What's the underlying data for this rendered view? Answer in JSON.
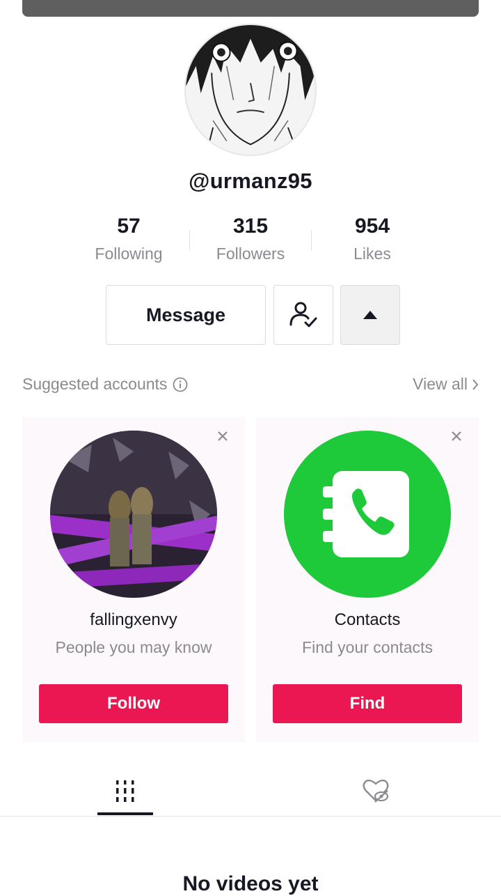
{
  "profile": {
    "username": "@urmanz95",
    "avatar_icon": "manga-portrait-avatar"
  },
  "stats": [
    {
      "value": "57",
      "label": "Following"
    },
    {
      "value": "315",
      "label": "Followers"
    },
    {
      "value": "954",
      "label": "Likes"
    }
  ],
  "actions": {
    "message_label": "Message",
    "friends_icon": "user-check-icon",
    "toggle_icon": "caret-up-icon"
  },
  "suggested": {
    "heading": "Suggested accounts",
    "view_all": "View all",
    "cards": [
      {
        "name": "fallingxenvy",
        "subtitle": "People you may know",
        "button": "Follow"
      },
      {
        "name": "Contacts",
        "subtitle": "Find your contacts",
        "button": "Find"
      }
    ]
  },
  "tabs": {
    "videos_icon": "grid-icon",
    "liked_icon": "hidden-heart-icon"
  },
  "empty_state": "No videos yet",
  "colors": {
    "accent": "#ea1753",
    "contacts_green": "#1fca3a"
  }
}
